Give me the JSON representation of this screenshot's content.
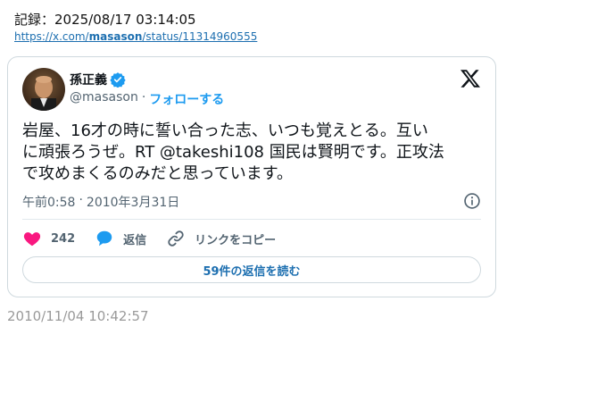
{
  "record": {
    "label": "記録：2025/08/17 03:14:05",
    "url_prefix": "https://x.com/",
    "url_user": "masason",
    "url_suffix": "/status/11314960555"
  },
  "tweet": {
    "display_name": "孫正義",
    "handle": "@masason",
    "separator": "·",
    "follow_label": "フォローする",
    "text_line1": "岩屋、16才の時に誓い合った志、いつも覚えとる。互い",
    "text_line2": "に頑張ろうぜ。RT @takeshi108 国民は賢明です。正攻法",
    "text_line3": "で攻めまくるのみだと思っています。",
    "time": "午前0:58",
    "date_separator": "·",
    "date": "2010年3月31日",
    "likes": "242",
    "reply_label": "返信",
    "copy_link_label": "リンクをコピー",
    "read_replies_label": "59件の返信を読む"
  },
  "archive_time": "2010/11/04 10:42:57",
  "colors": {
    "accent": "#1d9bf0",
    "like": "#f91880",
    "verified": "#1d9bf0"
  },
  "icons": {
    "verified": "verified-badge-icon",
    "x_logo": "x-logo-icon",
    "info": "info-icon",
    "like": "heart-icon",
    "reply": "speech-bubble-icon",
    "copy_link": "link-icon"
  }
}
